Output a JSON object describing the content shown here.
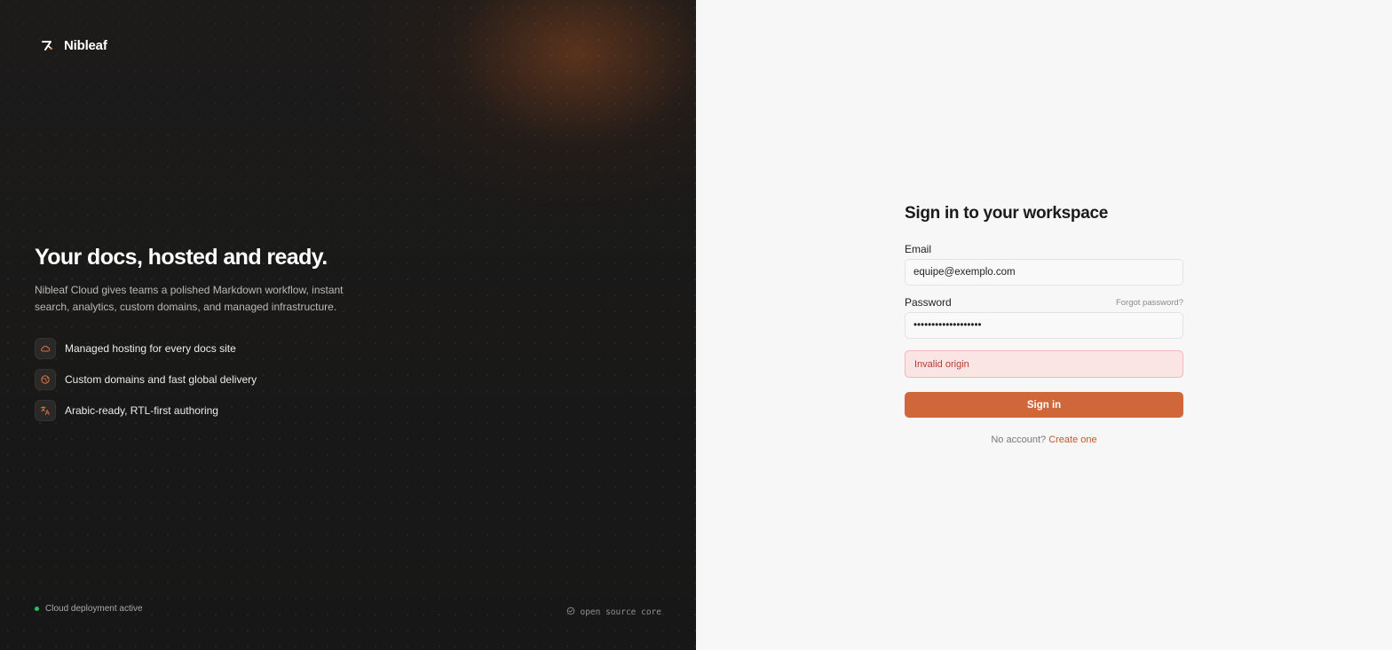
{
  "brand": {
    "name": "Nibleaf",
    "icon": "feather-pen-icon"
  },
  "hero": {
    "title": "Your docs, hosted and ready.",
    "description": "Nibleaf Cloud gives teams a polished Markdown workflow, instant search, analytics, custom domains, and managed infrastructure."
  },
  "features": [
    {
      "icon": "cloud-icon",
      "label": "Managed hosting for every docs site"
    },
    {
      "icon": "globe-icon",
      "label": "Custom domains and fast global delivery"
    },
    {
      "icon": "translate-icon",
      "label": "Arabic-ready, RTL-first authoring"
    }
  ],
  "footer": {
    "status": "Cloud deployment active",
    "open_source": "open source core"
  },
  "signin": {
    "title": "Sign in to your workspace",
    "email_label": "Email",
    "email_value": "equipe@exemplo.com",
    "password_label": "Password",
    "password_value": "•••••••••••••••••••",
    "forgot_link": "Forgot password?",
    "error": "Invalid origin",
    "button": "Sign in",
    "no_account": "No account?",
    "create_link": "Create one"
  },
  "colors": {
    "accent": "#d0673a",
    "error_bg": "#fbe4e4",
    "error_text": "#b93a32",
    "status_green": "#22c55e"
  }
}
